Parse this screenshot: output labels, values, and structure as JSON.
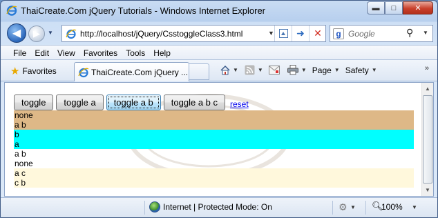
{
  "window": {
    "title": "ThaiCreate.Com jQuery Tutorials - Windows Internet Explorer",
    "min_glyph": "▬",
    "max_glyph": "□",
    "close_glyph": "✕"
  },
  "nav": {
    "back_glyph": "◀",
    "forward_glyph": "▶",
    "address": "http://localhost/jQuery/CsstoggleClass3.html",
    "search_placeholder": "Google",
    "search_engine_glyph": "g"
  },
  "menu": {
    "items": [
      "File",
      "Edit",
      "View",
      "Favorites",
      "Tools",
      "Help"
    ]
  },
  "commandbar": {
    "favorites_label": "Favorites",
    "tab_label": "ThaiCreate.Com jQuery ...",
    "page_label": "Page",
    "safety_label": "Safety",
    "chevron": "»"
  },
  "page": {
    "buttons": [
      "toggle",
      "toggle a",
      "toggle a b",
      "toggle a b c"
    ],
    "focused_button_index": 2,
    "reset_link": "reset",
    "rows": [
      {
        "text": "none",
        "bg": "#deb887"
      },
      {
        "text": "a b",
        "bg": "#deb887"
      },
      {
        "text": "b",
        "bg": "#00ffff"
      },
      {
        "text": "a",
        "bg": "#00ffff"
      },
      {
        "text": "a b",
        "bg": "transparent"
      },
      {
        "text": "none",
        "bg": "transparent"
      },
      {
        "text": "a c",
        "bg": "#fff8dc"
      },
      {
        "text": "c b",
        "bg": "#fff8dc"
      }
    ]
  },
  "status": {
    "zone": "Internet | Protected Mode: On",
    "zoom": "100%"
  },
  "colors": {
    "tan": "#deb887",
    "cyan": "#00ffff",
    "cornsilk": "#fff8dc",
    "link": "#0000ee"
  }
}
